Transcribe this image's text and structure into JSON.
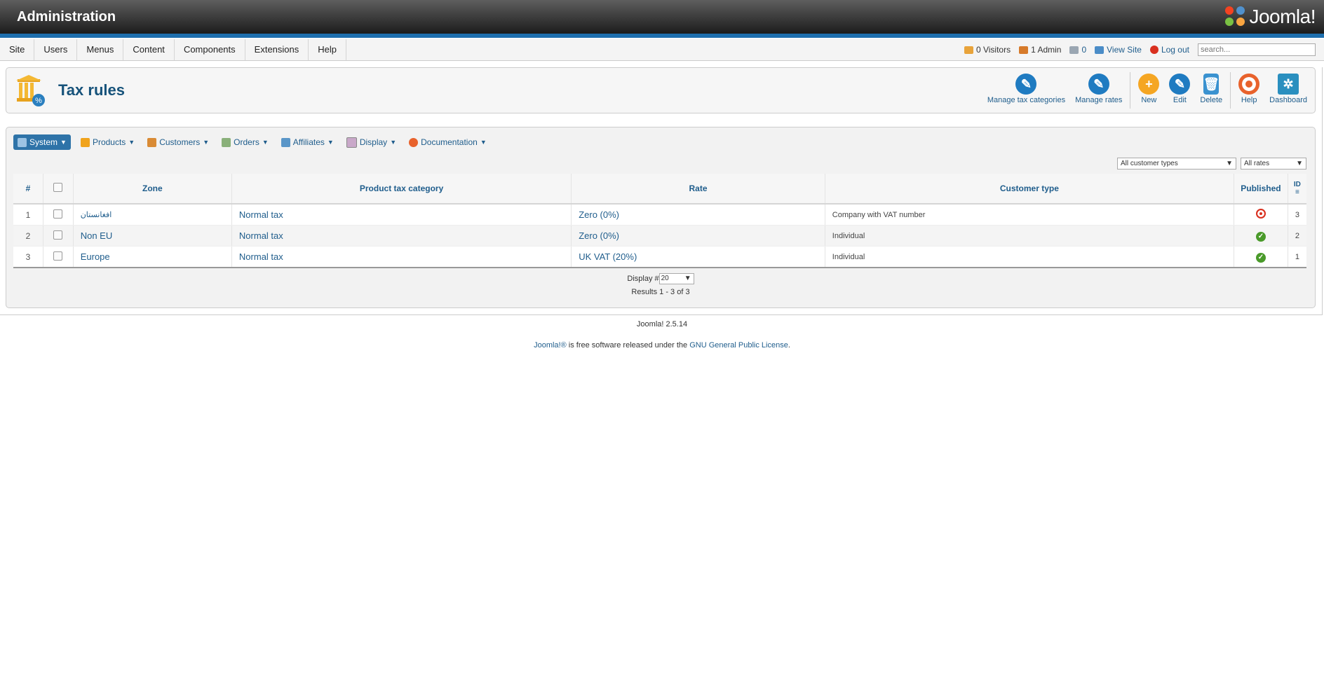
{
  "header": {
    "title": "Administration",
    "logo_text": "Joomla!"
  },
  "menu": [
    "Site",
    "Users",
    "Menus",
    "Content",
    "Components",
    "Extensions",
    "Help"
  ],
  "status": {
    "visitors": "0 Visitors",
    "admins": "1 Admin",
    "messages": "0",
    "view_site": "View Site",
    "logout": "Log out",
    "search_placeholder": "search..."
  },
  "page": {
    "title": "Tax rules"
  },
  "toolbar": [
    {
      "label": "Manage tax categories",
      "icon": "pencil-icon",
      "color": "#1f7bc1"
    },
    {
      "label": "Manage rates",
      "icon": "pencil-icon",
      "color": "#1f7bc1"
    },
    {
      "label": "New",
      "icon": "plus-icon",
      "color": "#f5a623"
    },
    {
      "label": "Edit",
      "icon": "pencil-icon",
      "color": "#1f7bc1"
    },
    {
      "label": "Delete",
      "icon": "trash-icon",
      "color": "#1f7bc1"
    },
    {
      "label": "Help",
      "icon": "lifebuoy-icon",
      "color": "#e8622c"
    },
    {
      "label": "Dashboard",
      "icon": "dashboard-icon",
      "color": "#2a8fbf"
    }
  ],
  "subnav": [
    "System",
    "Products",
    "Customers",
    "Orders",
    "Affiliates",
    "Display",
    "Documentation"
  ],
  "filters": {
    "customer_types": "All customer types",
    "rates": "All rates"
  },
  "table": {
    "headers": {
      "num": "#",
      "zone": "Zone",
      "category": "Product tax category",
      "rate": "Rate",
      "customer": "Customer type",
      "published": "Published",
      "id": "ID"
    },
    "rows": [
      {
        "num": "1",
        "zone": "افغانستان",
        "category": "Normal tax",
        "rate": "Zero (0%)",
        "customer": "Company with VAT number",
        "published": false,
        "id": "3"
      },
      {
        "num": "2",
        "zone": "Non EU",
        "category": "Normal tax",
        "rate": "Zero (0%)",
        "customer": "Individual",
        "published": true,
        "id": "2"
      },
      {
        "num": "3",
        "zone": "Europe",
        "category": "Normal tax",
        "rate": "UK VAT (20%)",
        "customer": "Individual",
        "published": true,
        "id": "1"
      }
    ]
  },
  "pagination": {
    "display_label": "Display #",
    "display_value": "20",
    "results": "Results 1 - 3 of 3"
  },
  "footer": {
    "version": "Joomla! 2.5.14",
    "license_prefix": "Joomla!®",
    "license_middle": " is free software released under the ",
    "license_link": "GNU General Public License",
    "license_suffix": "."
  }
}
